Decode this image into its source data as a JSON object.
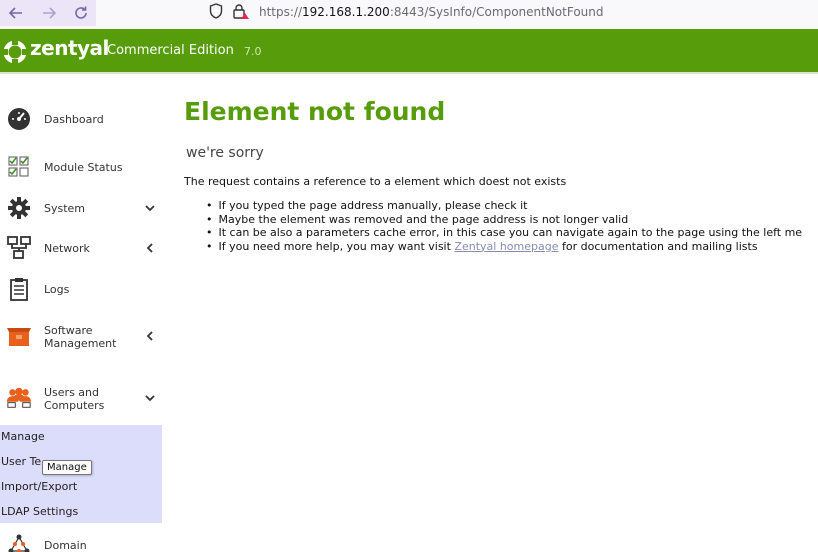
{
  "browser": {
    "url_scheme": "https://",
    "url_host": "192.168.1.200",
    "url_rest": ":8443/SysInfo/ComponentNotFound"
  },
  "header": {
    "logo_text": "zentyal",
    "edition": "Commercial Edition",
    "version": "7.0",
    "accent_color": "#579c0b"
  },
  "sidebar": {
    "items": [
      {
        "label": "Dashboard",
        "icon": "dashboard-gauge-icon"
      },
      {
        "label": "Module Status",
        "icon": "module-status-checkbox-icon"
      },
      {
        "label": "System",
        "icon": "gear-icon",
        "chevron": "down"
      },
      {
        "label": "Network",
        "icon": "network-icon",
        "chevron": "left"
      },
      {
        "label": "Logs",
        "icon": "clipboard-icon"
      },
      {
        "label_line1": "Software",
        "label_line2": "Management",
        "icon": "package-icon",
        "chevron": "left"
      },
      {
        "label_line1": "Users and",
        "label_line2": "Computers",
        "icon": "users-icon",
        "chevron": "down"
      },
      {
        "label": "Domain",
        "icon": "domain-icon"
      }
    ],
    "submenu": [
      "Manage",
      "User Te",
      "Import/Export",
      "LDAP Settings"
    ],
    "submenu_bg": "#dcdcfb"
  },
  "tooltip": {
    "text": "Manage"
  },
  "main": {
    "title": "Element not found",
    "subtitle": "we're sorry",
    "intro": "The request contains a reference to a element which doest not exists",
    "bullets": [
      "If you typed the page address manually, please check it",
      "Maybe the element was removed and the page address is not longer valid",
      "It can be also a parameters cache error, in this case you can navigate again to the page using the left me"
    ],
    "help_prefix": "If you need more help, you may want visit ",
    "help_link": "Zentyal homepage",
    "help_suffix": " for documentation and mailing lists"
  }
}
